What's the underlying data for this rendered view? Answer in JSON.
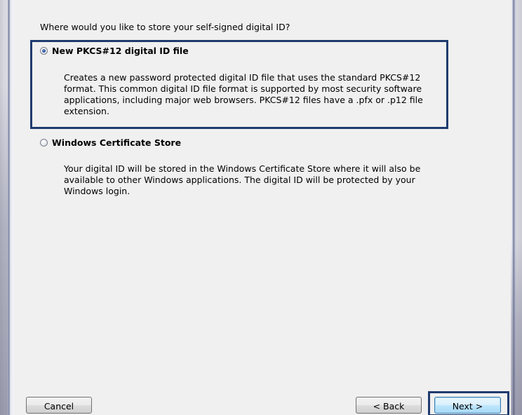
{
  "dialog": {
    "prompt": "Where would you like to store your self-signed digital ID?",
    "options": [
      {
        "label": "New PKCS#12 digital ID file",
        "selected": true,
        "description_lines": [
          "Creates a new password protected digital ID file that uses the standard PKCS#12",
          "format. This common digital ID file format is supported by most security software",
          "applications, including major web browsers. PKCS#12 files have a .pfx or .p12 file",
          "extension."
        ]
      },
      {
        "label": "Windows Certificate Store",
        "selected": false,
        "description_lines": [
          "Your digital ID will be stored in the Windows Certificate Store where it will also be",
          "available to other Windows applications. The digital ID will be protected by your",
          "Windows login."
        ]
      }
    ],
    "buttons": {
      "cancel": "Cancel",
      "back": "< Back",
      "next": "Next >"
    }
  },
  "colors": {
    "highlight_border": "#1f3b6f",
    "dialog_background": "#f0f0f0"
  }
}
